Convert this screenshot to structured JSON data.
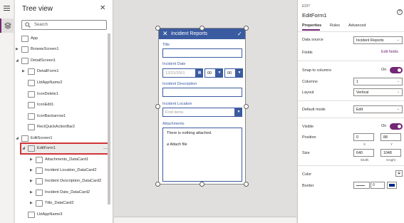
{
  "tree": {
    "title": "Tree view",
    "search_placeholder": "Search",
    "items": [
      {
        "label": "App"
      },
      {
        "label": "BrowseScreen1"
      },
      {
        "label": "DetailScreen1"
      },
      {
        "label": "DetailForm1"
      },
      {
        "label": "LblAppName2"
      },
      {
        "label": "IconDelete1"
      },
      {
        "label": "IconEdit1"
      },
      {
        "label": "IconBackarrow1"
      },
      {
        "label": "RectQuickActionBar2"
      },
      {
        "label": "EditScreen1"
      },
      {
        "label": "EditForm1"
      },
      {
        "label": "Attachments_DataCard1"
      },
      {
        "label": "Incident Location_DataCard2"
      },
      {
        "label": "Incident Description_DataCard2"
      },
      {
        "label": "Incident Date_DataCard2"
      },
      {
        "label": "Title_DataCard2"
      },
      {
        "label": "LblAppName3"
      }
    ],
    "more_label": "..."
  },
  "form": {
    "header_title": "Incident Reports",
    "fields": {
      "title_label": "Title",
      "date_label": "Incident Date",
      "date_value": "12/31/2001",
      "hour_value": "00",
      "minute_value": "00",
      "description_label": "Incident Description",
      "location_label": "Incident Location",
      "location_placeholder": "Find items",
      "attachments_label": "Attachments",
      "attachments_empty": "There is nothing attached.",
      "attach_file": "Attach file"
    }
  },
  "props": {
    "kind": "EDIT",
    "name": "EditForm1",
    "tabs": [
      "Properties",
      "Rules",
      "Advanced"
    ],
    "data_source_label": "Data source",
    "data_source_value": "Incident Reports",
    "fields_label": "Fields",
    "edit_fields_link": "Edit fields",
    "snap_label": "Snap to columns",
    "snap_state": "On",
    "columns_label": "Columns",
    "columns_value": "1",
    "layout_label": "Layout",
    "layout_value": "Vertical",
    "default_mode_label": "Default mode",
    "default_mode_value": "Edit",
    "visible_label": "Visible",
    "visible_state": "On",
    "position_label": "Position",
    "pos_x": "0",
    "pos_y": "88",
    "pos_x_sub": "X",
    "pos_y_sub": "Y",
    "size_label": "Size",
    "width": "640",
    "height": "1048",
    "width_sub": "Width",
    "height_sub": "Height",
    "color_label": "Color",
    "border_label": "Border",
    "border_width": "0",
    "accent_color": "#742774"
  }
}
